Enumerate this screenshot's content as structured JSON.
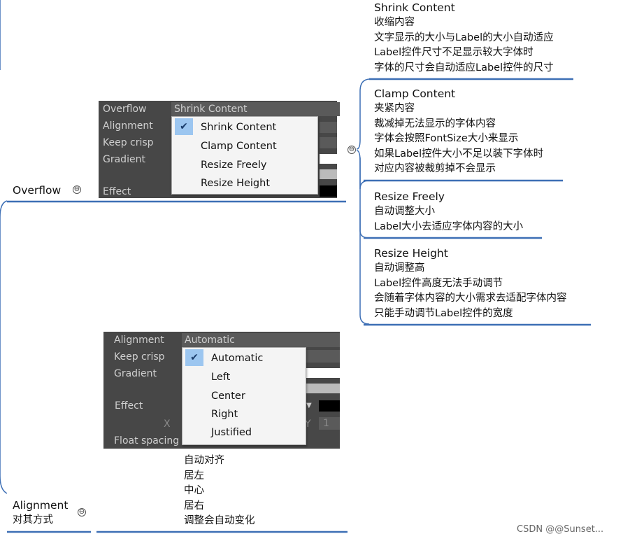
{
  "overflow": {
    "label": "Overflow",
    "toggle": "⊖",
    "screenshot": {
      "rows": [
        "Overflow",
        "Alignment",
        "Keep crisp",
        "Gradient",
        "Effect"
      ],
      "selected": "Shrink Content",
      "options": [
        "Shrink Content",
        "Clamp Content",
        "Resize Freely",
        "Resize Height"
      ],
      "checked_index": 0
    },
    "children_toggle": "⊖",
    "children": [
      {
        "title": "Shrink Content",
        "lines": [
          "收缩内容",
          "文字显示的大小与Label的大小自动适应",
          "Label控件尺寸不足显示较大字体时",
          "字体的尺寸会自动适应Label控件的尺寸"
        ]
      },
      {
        "title": "Clamp Content",
        "lines": [
          "夹紧内容",
          "裁减掉无法显示的字体内容",
          "字体会按照FontSize大小来显示",
          "如果Label控件大小不足以装下字体时",
          "对应内容被裁剪掉不会显示"
        ]
      },
      {
        "title": "Resize Freely",
        "lines": [
          "自动调整大小",
          "Label大小去适应字体内容的大小"
        ]
      },
      {
        "title": "Resize Height",
        "lines": [
          "自动调整高",
          "Label控件高度无法手动调节",
          "会随着字体内容的大小需求去适配字体内容",
          "只能手动调节Label控件的宽度"
        ]
      }
    ]
  },
  "alignment": {
    "label": "Alignment",
    "sublabel": "对其方式",
    "toggle": "⊖",
    "screenshot": {
      "rows": [
        "Alignment",
        "Keep crisp",
        "Gradient",
        "Effect",
        "X",
        "Float spacing"
      ],
      "selected": "Automatic",
      "options": [
        "Automatic",
        "Left",
        "Center",
        "Right",
        "Justified"
      ],
      "checked_index": 0,
      "extra": [
        "Y",
        "1"
      ]
    },
    "lines": [
      "自动对齐",
      "居左",
      "中心",
      "居右",
      "调整会自动变化"
    ]
  },
  "colors": {
    "line": "#3d6fb5",
    "shot_bg": "#474747",
    "check_bg": "#9cc6f0"
  },
  "watermark": "CSDN @@Sunset..."
}
